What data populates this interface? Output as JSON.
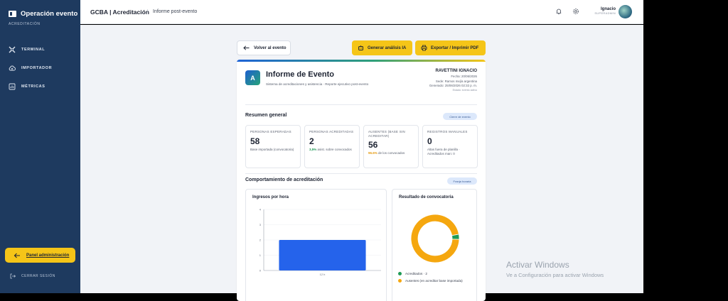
{
  "sidebar": {
    "title": "Operación evento",
    "subtitle": "ACREDITACIÓN",
    "items": [
      {
        "label": "TERMINAL",
        "icon": "terminal-icon"
      },
      {
        "label": "IMPORTADOR",
        "icon": "cloud-upload-icon"
      },
      {
        "label": "MÉTRICAS",
        "icon": "chart-icon"
      }
    ],
    "admin_label": "Panel administración",
    "logout_label": "CERRAR SESIÓN"
  },
  "topbar": {
    "crumb1": "GCBA | Acreditación",
    "separator": "/",
    "crumb2": "Informe post-evento",
    "user_name": "Ignacio",
    "user_role": "SUPERADMIN"
  },
  "actions": {
    "back": "Volver al evento",
    "ai": "Generar análisis IA",
    "pdf": "Exportar / Imprimir PDF"
  },
  "report": {
    "badge": "A",
    "title": "Informe de Evento",
    "subtitle": "Sistema de acreditaciones y asistencia · Reporte ejecutivo post-evento",
    "owner": "RAVETTINI IGNACIO",
    "date": "Fecha: 20/06/2026",
    "venue": "Sede: Ramos mejía argentina",
    "generated": "Generado: 25/06/2026 02:32 p. m.",
    "status": "Estado: evento activo"
  },
  "summary": {
    "title": "Resumen general",
    "pill": "Cierre de evento",
    "kpis": [
      {
        "label": "PERSONAS ESPERADAS",
        "value": "58",
        "desc_prefix": "",
        "desc": "Base importada (convocatoria)",
        "tone": ""
      },
      {
        "label": "PERSONAS ACREDITADAS",
        "value": "2",
        "desc_prefix": "3,5%",
        "desc": "asist. sobre convocados",
        "tone": "g"
      },
      {
        "label": "AUSENTES (BASE SIN ACREDITAR)",
        "value": "56",
        "desc_prefix": "96.6%",
        "desc": "de los convocados",
        "tone": "o"
      },
      {
        "label": "REGISTROS MANUALES",
        "value": "0",
        "desc_prefix": "",
        "desc": "Altas fuera de planilla · Acreditados man: 0",
        "tone": ""
      }
    ]
  },
  "behavior": {
    "title": "Comportamiento de acreditación",
    "pill": "Franja horaria"
  },
  "chart_data": [
    {
      "type": "bar",
      "title": "Ingresos por hora",
      "categories": [
        "12 h"
      ],
      "values": [
        2
      ],
      "ylim": [
        0,
        4
      ],
      "yticks": [
        "0",
        "1",
        "2",
        "3",
        "4"
      ],
      "grid": true,
      "color": "#2563eb"
    },
    {
      "type": "pie",
      "title": "Resultado de convocatoria",
      "labels": [
        "Acreditados · 2",
        "Ausentes (en acreditar base importada)"
      ],
      "values": [
        2,
        56
      ],
      "colors": [
        "#1f9a56",
        "#f5a70f"
      ],
      "donut": true,
      "legend": "bottom"
    }
  ],
  "watermark": {
    "title": "Activar Windows",
    "subtitle": "Ve a Configuración para activar Windows"
  }
}
